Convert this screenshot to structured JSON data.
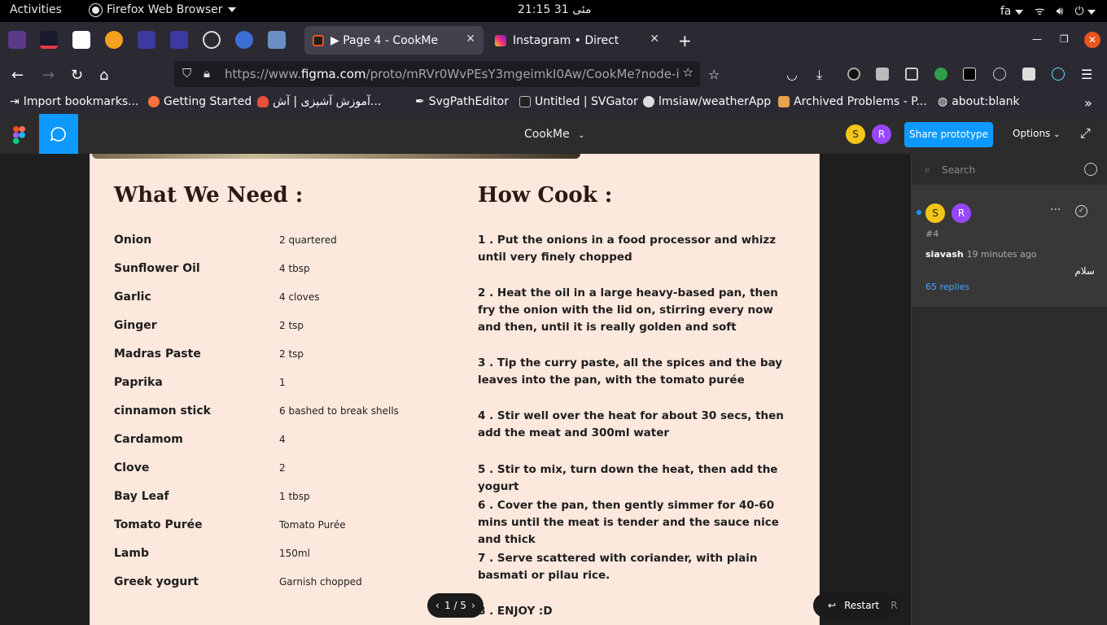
{
  "os_bar": {
    "activities": "Activities",
    "app_name": "Firefox Web Browser",
    "clock": "مئی 31  21:15",
    "lang": "fa"
  },
  "tabs": [
    {
      "title": "▶ Page 4 - CookMe",
      "active": true
    },
    {
      "title": "Instagram • Direct",
      "active": false
    }
  ],
  "nav": {
    "url_prefix": "https://www.",
    "url_domain": "figma.com",
    "url_rest": "/proto/mRVr0WvPEsY3mgeimkI0Aw/CookMe?node-id"
  },
  "bookmarks": [
    "Import bookmarks...",
    "Getting Started",
    "آموزش آشپزی | آش...",
    "SvgPathEditor",
    "Untitled | SVGator",
    "lmsiaw/weatherApp",
    "Archived Problems - P...",
    "about:blank"
  ],
  "figma": {
    "file_title": "CookMe",
    "avatars": [
      "S",
      "R"
    ],
    "share_label": "Share prototype",
    "options_label": "Options"
  },
  "recipe": {
    "ingredients_title": "What We Need :",
    "steps_title": "How Cook :",
    "ingredients": [
      {
        "name": "Onion",
        "qty": "2 quartered"
      },
      {
        "name": "Sunflower Oil",
        "qty": "4 tbsp"
      },
      {
        "name": "Garlic",
        "qty": "4 cloves"
      },
      {
        "name": "Ginger",
        "qty": "2 tsp"
      },
      {
        "name": "Madras Paste",
        "qty": "2 tsp"
      },
      {
        "name": "Paprika",
        "qty": "1"
      },
      {
        "name": "cinnamon stick",
        "qty": "6 bashed to break shells"
      },
      {
        "name": "Cardamom",
        "qty": "4"
      },
      {
        "name": "Clove",
        "qty": "2"
      },
      {
        "name": "Bay Leaf",
        "qty": "1 tbsp"
      },
      {
        "name": "Tomato Purée",
        "qty": "Tomato Purée"
      },
      {
        "name": "Lamb",
        "qty": "150ml"
      },
      {
        "name": "Greek yogurt",
        "qty": "Garnish chopped"
      }
    ],
    "steps": [
      "1 .  Put the onions in a food processor and whizz until very finely chopped",
      "2 .  Heat the oil in a large heavy-based pan, then fry the onion with the lid on, stirring every now and then, until it is really golden and soft",
      "3 .  Tip the curry paste, all the spices and the bay leaves into the pan, with the tomato purée",
      "4 .  Stir well over the heat for about 30 secs, then add the meat and 300ml water",
      "5 .  Stir to mix, turn down the heat, then add the yogurt",
      "6 .  Cover the pan, then gently simmer for 40-60 mins until the meat is tender and the sauce nice and thick",
      "7 .  Serve scattered with coriander, with plain basmati or pilau rice.",
      "8 .  ENJOY :D"
    ]
  },
  "pager": {
    "label": "1 / 5"
  },
  "restart": {
    "label": "Restart",
    "key": "R"
  },
  "comments": {
    "search_placeholder": "Search",
    "thread": {
      "avatars": [
        "S",
        "R"
      ],
      "number": "#4",
      "author": "siavash",
      "time": "19 minutes ago",
      "message": "سلام",
      "replies": "65 replies"
    }
  },
  "colors": {
    "figma_blue": "#0d99ff",
    "frame_bg": "#fde8dd",
    "avatar_s": "#f5c518",
    "avatar_r": "#9747ff"
  }
}
